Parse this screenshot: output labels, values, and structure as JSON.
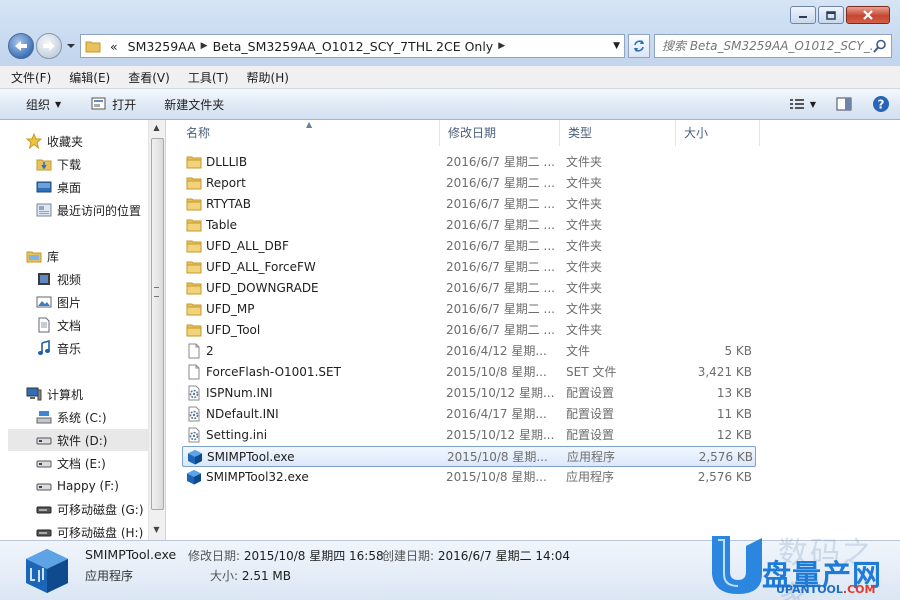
{
  "address": {
    "crumbs": [
      "«",
      "SM3259AA",
      "Beta_SM3259AA_O1012_SCY_7THL 2CE Only"
    ],
    "search_placeholder": "搜索 Beta_SM3259AA_O1012_SCY_..."
  },
  "menu": [
    "文件(F)",
    "编辑(E)",
    "查看(V)",
    "工具(T)",
    "帮助(H)"
  ],
  "toolbar": {
    "organize": "组织",
    "open": "打开",
    "new_folder": "新建文件夹"
  },
  "nav": {
    "favorites": {
      "label": "收藏夹",
      "items": [
        "下载",
        "桌面",
        "最近访问的位置"
      ]
    },
    "libraries": {
      "label": "库",
      "items": [
        "视频",
        "图片",
        "文档",
        "音乐"
      ]
    },
    "computer": {
      "label": "计算机",
      "items": [
        "系统 (C:)",
        "软件 (D:)",
        "文档 (E:)",
        "Happy (F:)",
        "可移动磁盘 (G:)",
        "可移动磁盘 (H:)"
      ]
    }
  },
  "columns": {
    "name": "名称",
    "date": "修改日期",
    "type": "类型",
    "size": "大小"
  },
  "files": [
    {
      "name": "DLLLIB",
      "date": "2016/6/7 星期二 ...",
      "type": "文件夹",
      "size": "",
      "icon": "folder"
    },
    {
      "name": "Report",
      "date": "2016/6/7 星期二 ...",
      "type": "文件夹",
      "size": "",
      "icon": "folder"
    },
    {
      "name": "RTYTAB",
      "date": "2016/6/7 星期二 ...",
      "type": "文件夹",
      "size": "",
      "icon": "folder"
    },
    {
      "name": "Table",
      "date": "2016/6/7 星期二 ...",
      "type": "文件夹",
      "size": "",
      "icon": "folder"
    },
    {
      "name": "UFD_ALL_DBF",
      "date": "2016/6/7 星期二 ...",
      "type": "文件夹",
      "size": "",
      "icon": "folder"
    },
    {
      "name": "UFD_ALL_ForceFW",
      "date": "2016/6/7 星期二 ...",
      "type": "文件夹",
      "size": "",
      "icon": "folder"
    },
    {
      "name": "UFD_DOWNGRADE",
      "date": "2016/6/7 星期二 ...",
      "type": "文件夹",
      "size": "",
      "icon": "folder"
    },
    {
      "name": "UFD_MP",
      "date": "2016/6/7 星期二 ...",
      "type": "文件夹",
      "size": "",
      "icon": "folder"
    },
    {
      "name": "UFD_Tool",
      "date": "2016/6/7 星期二 ...",
      "type": "文件夹",
      "size": "",
      "icon": "folder"
    },
    {
      "name": "2",
      "date": "2016/4/12 星期...",
      "type": "文件",
      "size": "5 KB",
      "icon": "file"
    },
    {
      "name": "ForceFlash-O1001.SET",
      "date": "2015/10/8 星期...",
      "type": "SET 文件",
      "size": "3,421 KB",
      "icon": "file"
    },
    {
      "name": "ISPNum.INI",
      "date": "2015/10/12 星期...",
      "type": "配置设置",
      "size": "13 KB",
      "icon": "ini"
    },
    {
      "name": "NDefault.INI",
      "date": "2016/4/17 星期...",
      "type": "配置设置",
      "size": "11 KB",
      "icon": "ini"
    },
    {
      "name": "Setting.ini",
      "date": "2015/10/12 星期...",
      "type": "配置设置",
      "size": "12 KB",
      "icon": "ini"
    },
    {
      "name": "SMIMPTool.exe",
      "date": "2015/10/8 星期...",
      "type": "应用程序",
      "size": "2,576 KB",
      "icon": "exe",
      "selected": true
    },
    {
      "name": "SMIMPTool32.exe",
      "date": "2015/10/8 星期...",
      "type": "应用程序",
      "size": "2,576 KB",
      "icon": "exe"
    }
  ],
  "details": {
    "name": "SMIMPTool.exe",
    "type": "应用程序",
    "modified_label": "修改日期:",
    "modified": "2015/10/8 星期四 16:58",
    "created_label": "创建日期:",
    "created": "2016/6/7 星期二 14:04",
    "size_label": "大小:",
    "size": "2.51 MB"
  },
  "watermark": {
    "cn": "盘量产网",
    "faint": "数码之家",
    "en_blue": "UPANTOOL",
    "en_red": ".COM"
  }
}
